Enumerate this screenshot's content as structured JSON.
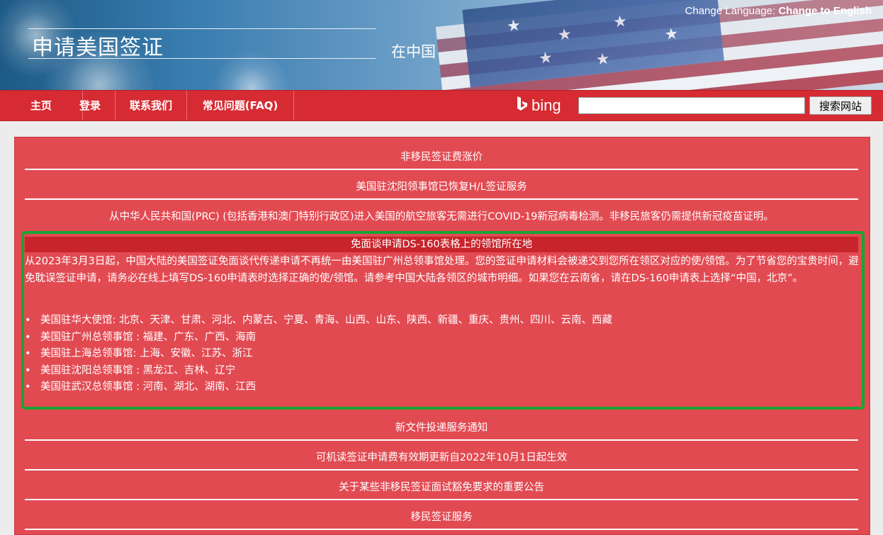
{
  "header": {
    "title": "申请美国签证",
    "subtitle": "在中国",
    "language_label": "Change Language: ",
    "language_link": "Change to English"
  },
  "nav": {
    "items": [
      "主页",
      "登录",
      "联系我们",
      "常见问题(FAQ)"
    ],
    "search_brand": "bing",
    "search_placeholder": "",
    "search_button": "搜索网站"
  },
  "notices": {
    "fee": "非移民签证费涨价",
    "shenyang": "美国驻沈阳领事馆已恢复H/L签证服务",
    "covid": "从中华人民共和国(PRC) (包括香港和澳门特别行政区)进入美国的航空旅客无需进行COVID-19新冠病毒检测。非移民旅客仍需提供新冠疫苗证明。",
    "highlight_title": "免面谈申请DS-160表格上的领馆所在地",
    "highlight_body": "从2023年3月3日起，中国大陆的美国签证免面谈代传递申请不再统一由美国驻广州总领事馆处理。您的签证申请材料会被递交到您所在领区对应的使/领馆。为了节省您的宝贵时间，避免耽误签证申请，请务必在线上填写DS-160申请表时选择正确的使/领馆。请参考中国大陆各领区的城市明细。如果您在云南省，请在DS-160申请表上选择“中国，北京”。",
    "posts": [
      "美国驻华大使馆: 北京、天津、甘肃、河北、内蒙古、宁夏、青海、山西、山东、陕西、新疆、重庆、贵州、四川、云南、西藏",
      "美国驻广州总领事馆 : 福建、广东、广西、海南",
      "美国驻上海总领事馆: 上海、安徽、江苏、浙江",
      "美国驻沈阳总领事馆 : 黑龙江、吉林、辽宁",
      "美国驻武汉总领事馆 : 河南、湖北、湖南、江西"
    ],
    "delivery": "新文件投递服务通知",
    "mrv": "可机读签证申请费有效期更新自2022年10月1日起生效",
    "waiver": "关于某些非移民签证面试豁免要求的重要公告",
    "immigrant": "移民签证服务"
  },
  "colors": {
    "nav_red": "#d62b32",
    "panel_red": "#e24a52",
    "highlight_green": "#17a534"
  }
}
